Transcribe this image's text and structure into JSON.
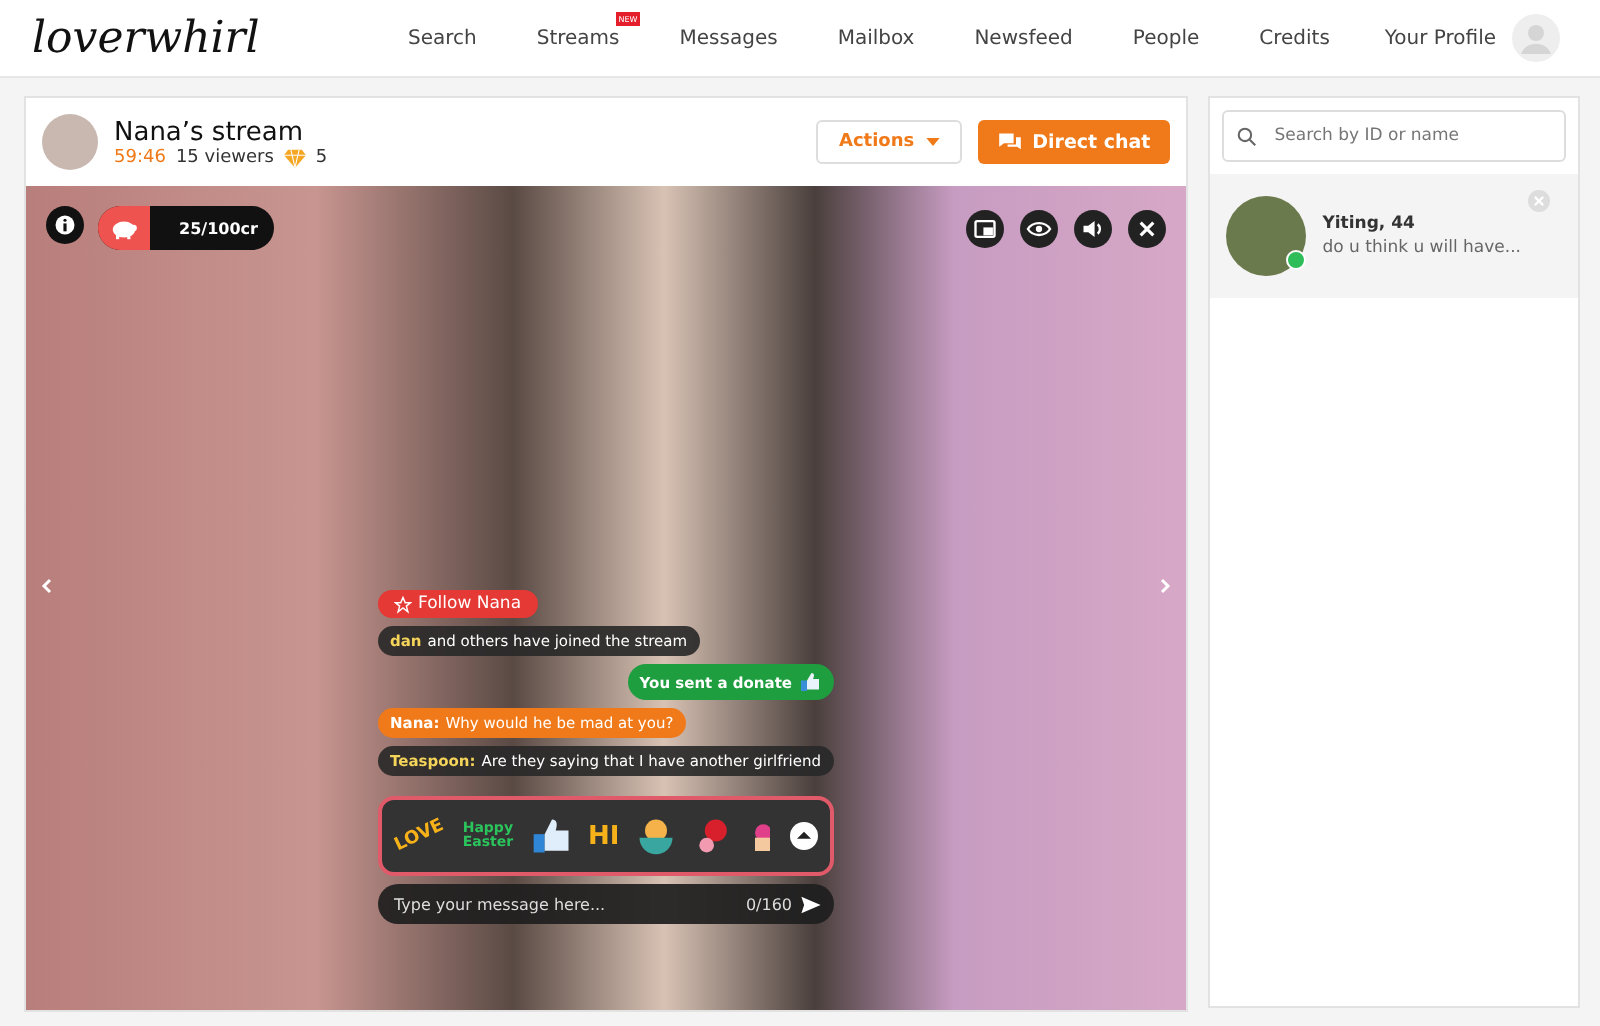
{
  "logo": "loverwhirl",
  "nav": [
    {
      "label": "Search"
    },
    {
      "label": "Streams",
      "badge": "NEW"
    },
    {
      "label": "Messages"
    },
    {
      "label": "Mailbox"
    },
    {
      "label": "Newsfeed"
    },
    {
      "label": "People"
    },
    {
      "label": "Credits"
    }
  ],
  "profile": {
    "label": "Your Profile"
  },
  "stream": {
    "title": "Nana’s stream",
    "time": "59:46",
    "viewers": "15 viewers",
    "gems": "5",
    "actions": "Actions",
    "direct_chat": "Direct chat"
  },
  "video": {
    "credits": "25/100cr",
    "follow": "Follow Nana"
  },
  "chat": [
    {
      "kind": "system",
      "name": "dan",
      "text": "and others have joined the stream"
    },
    {
      "kind": "self",
      "text": "You sent a donate"
    },
    {
      "kind": "host",
      "name": "Nana:",
      "text": "Why would he be mad at you?"
    },
    {
      "kind": "viewer",
      "name": "Teaspoon:",
      "text": "Are they saying that I have another girlfriend"
    }
  ],
  "stickers": [
    {
      "kind": "love",
      "text": "LOVE"
    },
    {
      "kind": "easter",
      "text": "Happy Easter"
    },
    {
      "kind": "thumb"
    },
    {
      "kind": "hi",
      "text": "HI"
    },
    {
      "kind": "chick"
    },
    {
      "kind": "roses"
    },
    {
      "kind": "cupcake"
    }
  ],
  "message": {
    "placeholder": "Type your message here...",
    "counter": "0/160"
  },
  "sidebar": {
    "search": {
      "placeholder": "Search by ID or name"
    },
    "contacts": [
      {
        "name": "Yiting, 44",
        "preview": "do u think u will have...",
        "online": true
      }
    ]
  }
}
